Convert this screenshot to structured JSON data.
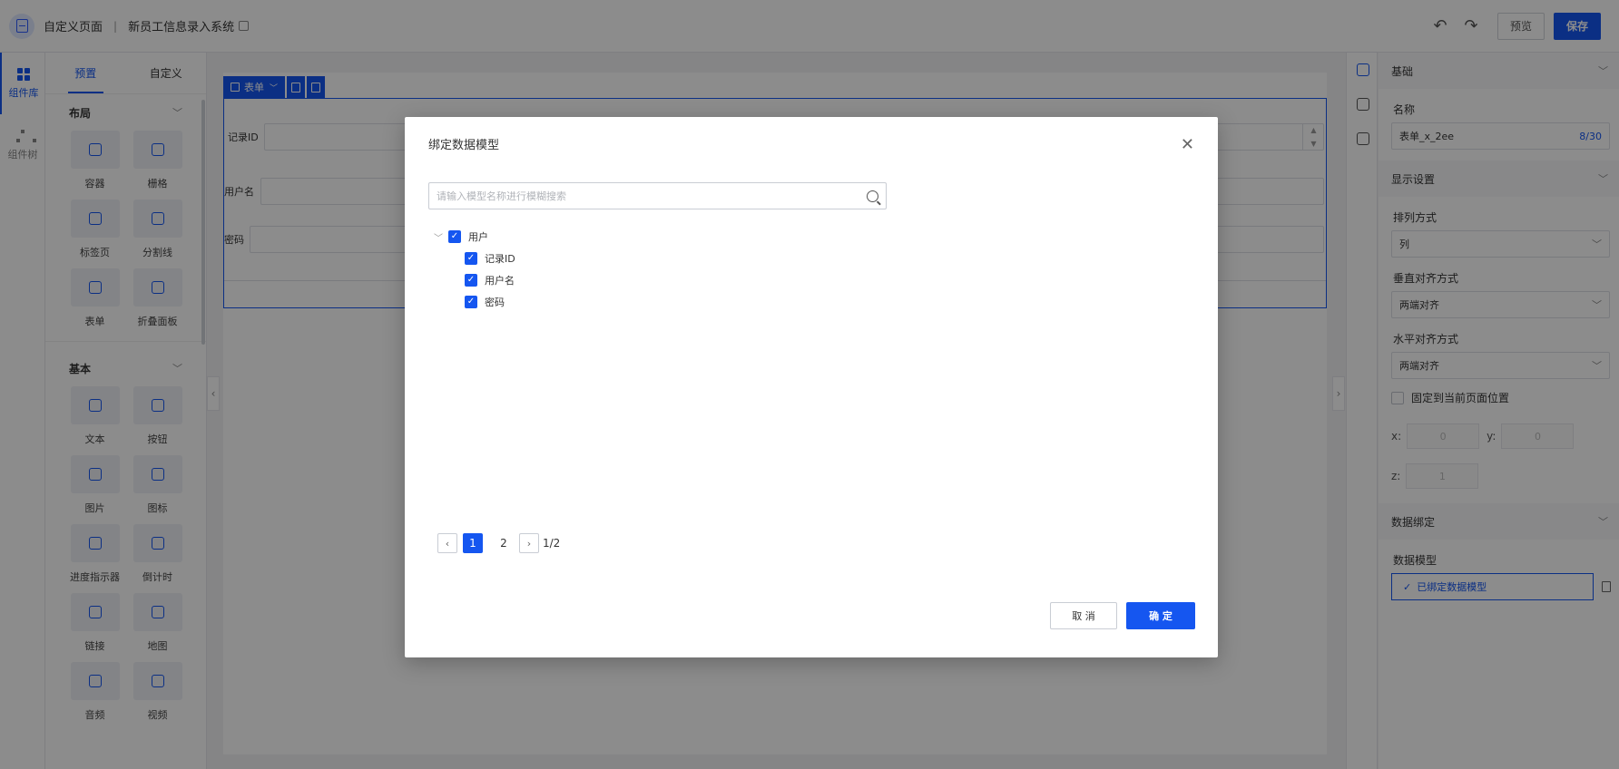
{
  "header": {
    "title": "自定义页面",
    "separator": "|",
    "subtitle": "新员工信息录入系统",
    "preview_label": "预览",
    "save_label": "保存"
  },
  "rail": {
    "items": [
      {
        "label": "组件库"
      },
      {
        "label": "组件树"
      }
    ]
  },
  "panel": {
    "tabs": [
      "预置",
      "自定义"
    ],
    "layout_section": "布局",
    "layout_items": [
      "容器",
      "栅格",
      "标签页",
      "分割线",
      "表单",
      "折叠面板"
    ],
    "basic_section": "基本",
    "basic_items": [
      "文本",
      "按钮",
      "图片",
      "图标",
      "进度指示器",
      "倒计时",
      "链接",
      "地图",
      "音频",
      "视频"
    ]
  },
  "canvas": {
    "form_tag": "表单",
    "fields": [
      "记录ID",
      "用户名",
      "密码"
    ]
  },
  "props": {
    "basic_section": "基础",
    "name_label": "名称",
    "name_value": "表单_x_2ee",
    "name_count": "8/30",
    "display_section": "显示设置",
    "arrange_label": "排列方式",
    "arrange_value": "列",
    "valign_label": "垂直对齐方式",
    "valign_value": "两端对齐",
    "halign_label": "水平对齐方式",
    "halign_value": "两端对齐",
    "fixed_label": "固定到当前页面位置",
    "x_label": "x:",
    "x_value": "0",
    "y_label": "y:",
    "y_value": "0",
    "z_label": "z:",
    "z_value": "1",
    "binding_section": "数据绑定",
    "model_label": "数据模型",
    "model_value": "已绑定数据模型"
  },
  "modal": {
    "title": "绑定数据模型",
    "search_placeholder": "请输入模型名称进行模糊搜索",
    "tree": {
      "root": "用户",
      "children": [
        "记录ID",
        "用户名",
        "密码"
      ]
    },
    "pager": {
      "pages": [
        "1",
        "2"
      ],
      "current": "1",
      "total": "1/2"
    },
    "cancel_label": "取 消",
    "ok_label": "确 定"
  },
  "colors": {
    "accent": "#1556f0",
    "overlay": "rgba(0,0,0,0.45)"
  }
}
